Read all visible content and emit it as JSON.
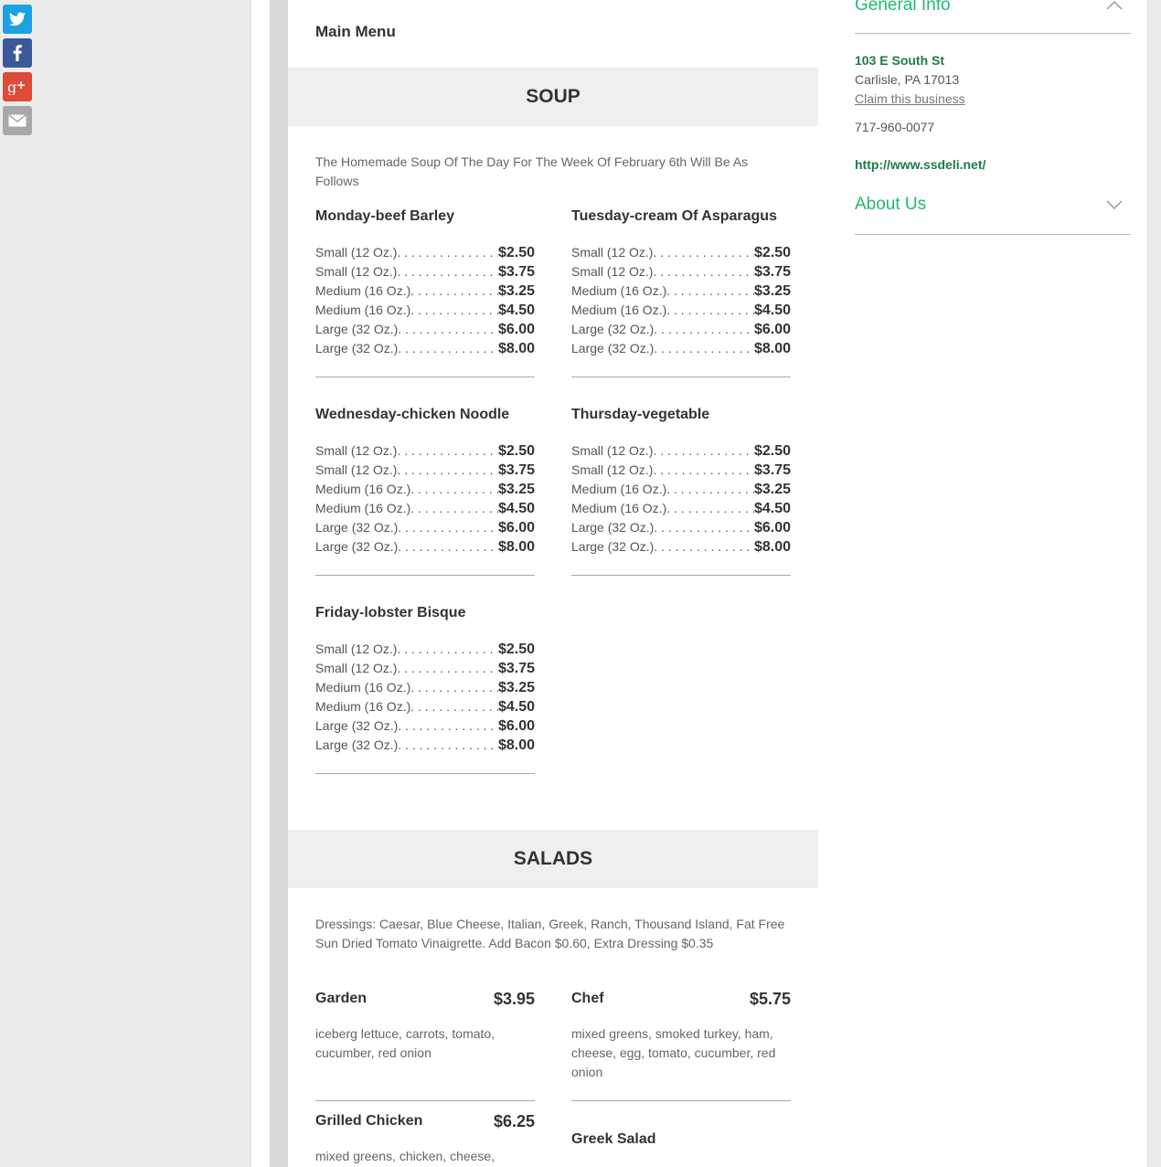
{
  "social": [
    {
      "name": "twitter",
      "color": "#1da1e2",
      "icon": "twitter-icon"
    },
    {
      "name": "facebook",
      "color": "#3b5998",
      "icon": "facebook-icon"
    },
    {
      "name": "google-plus",
      "color": "#dd4b39",
      "icon": "google-plus-icon"
    },
    {
      "name": "email",
      "color": "#a8a8a8",
      "icon": "email-icon"
    }
  ],
  "menu": {
    "title": "Main Menu",
    "soup": {
      "heading": "SOUP",
      "description": "The Homemade Soup Of The Day For The Week Of February 6th Will Be As Follows",
      "items": [
        {
          "name": "Monday-beef Barley",
          "prices": [
            {
              "label": "Small (12 Oz.)",
              "price": "$2.50"
            },
            {
              "label": "Small (12 Oz.)",
              "price": "$3.75"
            },
            {
              "label": "Medium (16 Oz.)",
              "price": "$3.25"
            },
            {
              "label": "Medium (16 Oz.)",
              "price": "$4.50"
            },
            {
              "label": "Large (32 Oz.)",
              "price": "$6.00"
            },
            {
              "label": "Large (32 Oz.)",
              "price": "$8.00"
            }
          ]
        },
        {
          "name": "Tuesday-cream Of Asparagus",
          "prices": [
            {
              "label": "Small (12 Oz.)",
              "price": "$2.50"
            },
            {
              "label": "Small (12 Oz.)",
              "price": "$3.75"
            },
            {
              "label": "Medium (16 Oz.)",
              "price": "$3.25"
            },
            {
              "label": "Medium (16 Oz.)",
              "price": "$4.50"
            },
            {
              "label": "Large (32 Oz.)",
              "price": "$6.00"
            },
            {
              "label": "Large (32 Oz.)",
              "price": "$8.00"
            }
          ]
        },
        {
          "name": "Wednesday-chicken Noodle",
          "prices": [
            {
              "label": "Small (12 Oz.)",
              "price": "$2.50"
            },
            {
              "label": "Small (12 Oz.)",
              "price": "$3.75"
            },
            {
              "label": "Medium (16 Oz.)",
              "price": "$3.25"
            },
            {
              "label": "Medium (16 Oz.)",
              "price": "$4.50"
            },
            {
              "label": "Large (32 Oz.)",
              "price": "$6.00"
            },
            {
              "label": "Large (32 Oz.)",
              "price": "$8.00"
            }
          ]
        },
        {
          "name": "Thursday-vegetable",
          "prices": [
            {
              "label": "Small (12 Oz.)",
              "price": "$2.50"
            },
            {
              "label": "Small (12 Oz.)",
              "price": "$3.75"
            },
            {
              "label": "Medium (16 Oz.)",
              "price": "$3.25"
            },
            {
              "label": "Medium (16 Oz.)",
              "price": "$4.50"
            },
            {
              "label": "Large (32 Oz.)",
              "price": "$6.00"
            },
            {
              "label": "Large (32 Oz.)",
              "price": "$8.00"
            }
          ]
        },
        {
          "name": "Friday-lobster Bisque",
          "prices": [
            {
              "label": "Small (12 Oz.)",
              "price": "$2.50"
            },
            {
              "label": "Small (12 Oz.)",
              "price": "$3.75"
            },
            {
              "label": "Medium (16 Oz.)",
              "price": "$3.25"
            },
            {
              "label": "Medium (16 Oz.)",
              "price": "$4.50"
            },
            {
              "label": "Large (32 Oz.)",
              "price": "$6.00"
            },
            {
              "label": "Large (32 Oz.)",
              "price": "$8.00"
            }
          ]
        }
      ]
    },
    "salads": {
      "heading": "SALADS",
      "description": "Dressings: Caesar, Blue Cheese, Italian, Greek, Ranch, Thousand Island, Fat Free Sun Dried Tomato Vinaigrette. Add Bacon $0.60, Extra Dressing $0.35",
      "items": [
        {
          "name": "Garden",
          "price": "$3.95",
          "description": "iceberg lettuce, carrots, tomato, cucumber, red onion"
        },
        {
          "name": "Chef",
          "price": "$5.75",
          "description": "mixed greens, smoked turkey, ham, cheese, egg, tomato, cucumber, red onion"
        },
        {
          "name": "Grilled Chicken",
          "price": "$6.25",
          "description": "mixed greens, chicken, cheese,"
        },
        {
          "name": "Greek Salad",
          "price": "",
          "description": ""
        }
      ]
    }
  },
  "sidebar": {
    "general_info_title": "General Info",
    "address_line1": "103 E South St",
    "address_line2": "Carlisle, PA 17013",
    "claim_link": "Claim this business",
    "phone": "717-960-0077",
    "website": "http://www.ssdeli.net/",
    "about_title": "About Us"
  },
  "colors": {
    "accent": "#1fba74",
    "link_dark": "#1e7a48"
  }
}
